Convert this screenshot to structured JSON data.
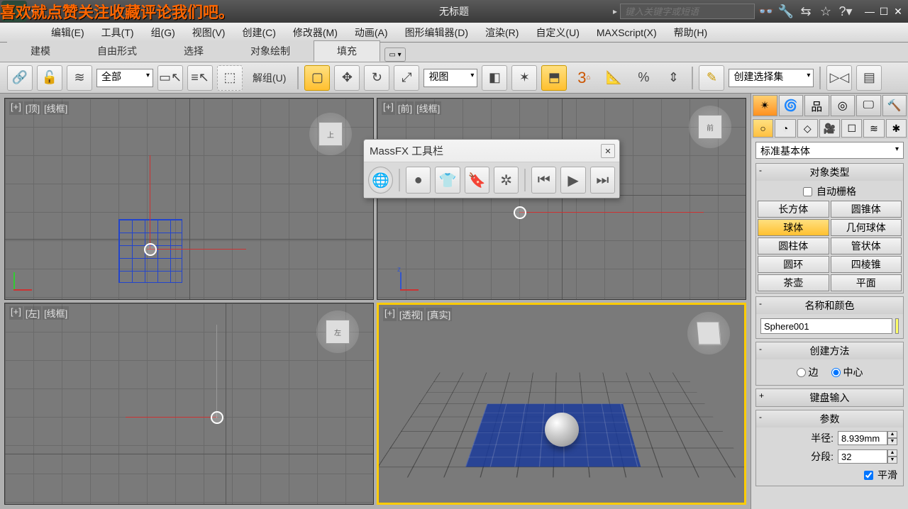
{
  "overlay_text": "喜欢就点赞关注收藏评论我们吧。",
  "title": "无标题",
  "search_placeholder": "键入关键字或短语",
  "menu": [
    "编辑(E)",
    "工具(T)",
    "组(G)",
    "视图(V)",
    "创建(C)",
    "修改器(M)",
    "动画(A)",
    "图形编辑器(D)",
    "渲染(R)",
    "自定义(U)",
    "MAXScript(X)",
    "帮助(H)"
  ],
  "ribbon_tabs": [
    "建模",
    "自由形式",
    "选择",
    "对象绘制",
    "填充"
  ],
  "ribbon_active": 4,
  "toolbar": {
    "filter_dropdown": "全部",
    "ungroup": "解组(U)",
    "coord_dropdown": "视图",
    "selset_dropdown": "创建选择集"
  },
  "viewports": {
    "tl": {
      "labels": [
        "[+]",
        "[顶]",
        "[线框]"
      ]
    },
    "tr": {
      "labels": [
        "[+]",
        "[前]",
        "[线框]"
      ]
    },
    "bl": {
      "labels": [
        "[+]",
        "[左]",
        "[线框]"
      ]
    },
    "br": {
      "labels": [
        "[+]",
        "[透视]",
        "[真实]"
      ]
    }
  },
  "massfx_title": "MassFX 工具栏",
  "cmd": {
    "category_dropdown": "标准基本体",
    "rollout_objtype": "对象类型",
    "auto_grid": "自动栅格",
    "objects": [
      "长方体",
      "圆锥体",
      "球体",
      "几何球体",
      "圆柱体",
      "管状体",
      "圆环",
      "四棱锥",
      "茶壶",
      "平面"
    ],
    "active_object": 2,
    "rollout_name": "名称和颜色",
    "object_name": "Sphere001",
    "rollout_method": "创建方法",
    "radio_edge": "边",
    "radio_center": "中心",
    "rollout_keyboard": "键盘输入",
    "rollout_params": "参数",
    "radius_label": "半径:",
    "radius_value": "8.939mm",
    "segments_label": "分段:",
    "segments_value": "32",
    "smooth_label": "平滑"
  }
}
